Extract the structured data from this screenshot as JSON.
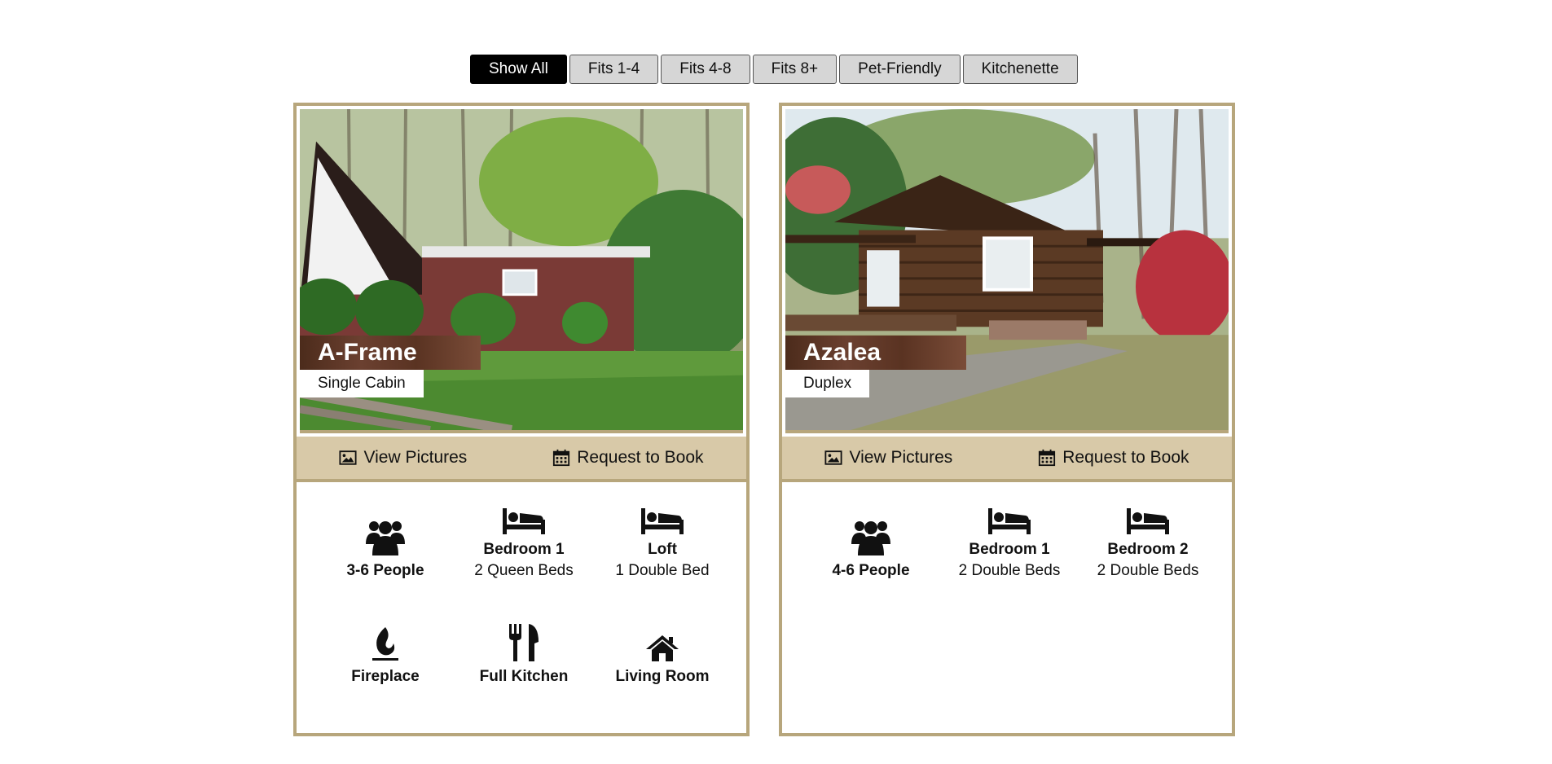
{
  "filters": [
    {
      "label": "Show All",
      "active": true
    },
    {
      "label": "Fits 1-4",
      "active": false
    },
    {
      "label": "Fits 4-8",
      "active": false
    },
    {
      "label": "Fits 8+",
      "active": false
    },
    {
      "label": "Pet-Friendly",
      "active": false
    },
    {
      "label": "Kitchenette",
      "active": false
    }
  ],
  "cabins": [
    {
      "name": "A-Frame",
      "type": "Single Cabin",
      "actions": {
        "view_pictures": "View Pictures",
        "request_to_book": "Request to Book"
      },
      "features": [
        {
          "icon": "people-icon",
          "title": "3-6 People",
          "subtitle": ""
        },
        {
          "icon": "bed-icon",
          "title": "Bedroom 1",
          "subtitle": "2 Queen Beds"
        },
        {
          "icon": "bed-icon",
          "title": "Loft",
          "subtitle": "1 Double Bed"
        },
        {
          "icon": "fireplace-icon",
          "title": "Fireplace",
          "subtitle": ""
        },
        {
          "icon": "kitchen-icon",
          "title": "Full Kitchen",
          "subtitle": ""
        },
        {
          "icon": "home-icon",
          "title": "Living Room",
          "subtitle": ""
        }
      ]
    },
    {
      "name": "Azalea",
      "type": "Duplex",
      "actions": {
        "view_pictures": "View Pictures",
        "request_to_book": "Request to Book"
      },
      "features": [
        {
          "icon": "people-icon",
          "title": "4-6 People",
          "subtitle": ""
        },
        {
          "icon": "bed-icon",
          "title": "Bedroom 1",
          "subtitle": "2 Double Beds"
        },
        {
          "icon": "bed-icon",
          "title": "Bedroom 2",
          "subtitle": "2 Double Beds"
        }
      ]
    }
  ],
  "colors": {
    "accent": "#b7a67c",
    "action_bar": "#d8c9a8",
    "active_filter": "#000000"
  }
}
